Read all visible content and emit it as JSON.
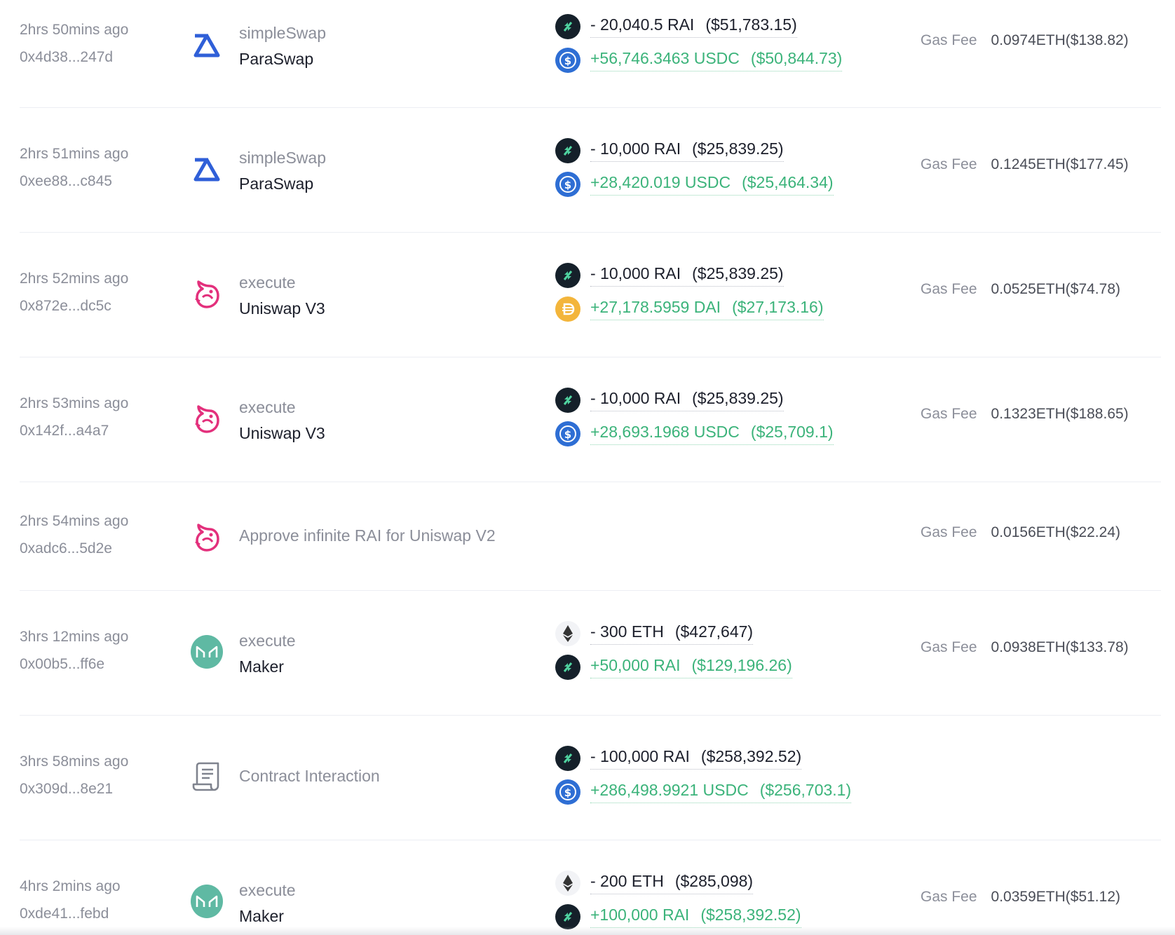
{
  "gas_label": "Gas Fee",
  "colors": {
    "positive": "#3bb37a",
    "muted": "#8b8e99",
    "text": "#1c1f2b",
    "rai": "#15202a",
    "usdc": "#2e6ed4",
    "dai": "#f3b53b",
    "maker": "#5fb9a3"
  },
  "transactions": [
    {
      "time": "2hrs 50mins ago",
      "hash": "0x4d38...247d",
      "protocol_icon": "paraswap-icon",
      "method": "simpleSwap",
      "protocol": "ParaSwap",
      "out": {
        "icon": "rai-token-icon",
        "amount": "- 20,040.5 RAI",
        "usd": "($51,783.15)"
      },
      "in": {
        "icon": "usdc-token-icon",
        "amount": "+56,746.3463 USDC",
        "usd": "($50,844.73)"
      },
      "gas": "0.0974ETH($138.82)"
    },
    {
      "time": "2hrs 51mins ago",
      "hash": "0xee88...c845",
      "protocol_icon": "paraswap-icon",
      "method": "simpleSwap",
      "protocol": "ParaSwap",
      "out": {
        "icon": "rai-token-icon",
        "amount": "- 10,000 RAI",
        "usd": "($25,839.25)"
      },
      "in": {
        "icon": "usdc-token-icon",
        "amount": "+28,420.019 USDC",
        "usd": "($25,464.34)"
      },
      "gas": "0.1245ETH($177.45)"
    },
    {
      "time": "2hrs 52mins ago",
      "hash": "0x872e...dc5c",
      "protocol_icon": "uniswap-icon",
      "method": "execute",
      "protocol": "Uniswap V3",
      "out": {
        "icon": "rai-token-icon",
        "amount": "- 10,000 RAI",
        "usd": "($25,839.25)"
      },
      "in": {
        "icon": "dai-token-icon",
        "amount": "+27,178.5959 DAI",
        "usd": "($27,173.16)"
      },
      "gas": "0.0525ETH($74.78)"
    },
    {
      "time": "2hrs 53mins ago",
      "hash": "0x142f...a4a7",
      "protocol_icon": "uniswap-icon",
      "method": "execute",
      "protocol": "Uniswap V3",
      "out": {
        "icon": "rai-token-icon",
        "amount": "- 10,000 RAI",
        "usd": "($25,839.25)"
      },
      "in": {
        "icon": "usdc-token-icon",
        "amount": "+28,693.1968 USDC",
        "usd": "($25,709.1)"
      },
      "gas": "0.1323ETH($188.65)"
    },
    {
      "time": "2hrs 54mins ago",
      "hash": "0xadc6...5d2e",
      "protocol_icon": "uniswap-icon",
      "method": "Approve infinite RAI for Uniswap V2",
      "gas": "0.0156ETH($22.24)"
    },
    {
      "time": "3hrs 12mins ago",
      "hash": "0x00b5...ff6e",
      "protocol_icon": "maker-icon",
      "method": "execute",
      "protocol": "Maker",
      "out": {
        "icon": "eth-token-icon",
        "amount": "- 300 ETH",
        "usd": "($427,647)"
      },
      "in": {
        "icon": "rai-token-icon",
        "amount": "+50,000 RAI",
        "usd": "($129,196.26)"
      },
      "gas": "0.0938ETH($133.78)"
    },
    {
      "time": "3hrs 58mins ago",
      "hash": "0x309d...8e21",
      "protocol_icon": "contract-scroll-icon",
      "method": "Contract Interaction",
      "out": {
        "icon": "rai-token-icon",
        "amount": "- 100,000 RAI",
        "usd": "($258,392.52)"
      },
      "in": {
        "icon": "usdc-token-icon",
        "amount": "+286,498.9921 USDC",
        "usd": "($256,703.1)"
      }
    },
    {
      "time": "4hrs 2mins ago",
      "hash": "0xde41...febd",
      "protocol_icon": "maker-icon",
      "method": "execute",
      "protocol": "Maker",
      "out": {
        "icon": "eth-token-icon",
        "amount": "- 200 ETH",
        "usd": "($285,098)"
      },
      "in": {
        "icon": "rai-token-icon",
        "amount": "+100,000 RAI",
        "usd": "($258,392.52)"
      },
      "gas": "0.0359ETH($51.12)"
    }
  ]
}
